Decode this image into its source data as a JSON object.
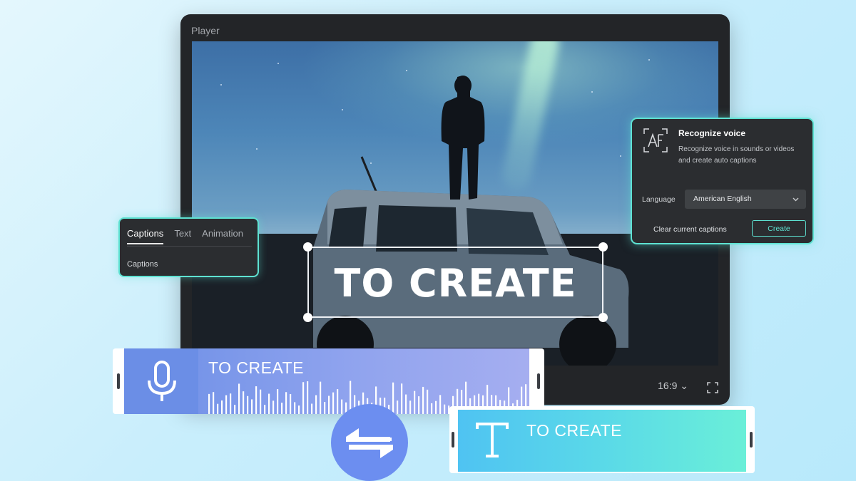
{
  "player": {
    "title": "Player",
    "aspect_ratio": "16:9",
    "caption_preview": "TO CREATE"
  },
  "captions_panel": {
    "tabs": [
      {
        "label": "Captions",
        "active": true
      },
      {
        "label": "Text",
        "active": false
      },
      {
        "label": "Animation",
        "active": false
      }
    ],
    "section_label": "Captions"
  },
  "voice_panel": {
    "title": "Recognize voice",
    "description": "Recognize voice in sounds or videos and create auto captions",
    "language_label": "Language",
    "language_value": "American English",
    "clear_label": "Clear current captions",
    "create_label": "Create",
    "icon": "auto-caption-icon"
  },
  "timeline": {
    "voice_clip_label": "TO CREATE",
    "text_clip_label": "TO CREATE",
    "voice_icon": "microphone-icon",
    "text_icon": "text-t-icon",
    "convert_icon": "convert-arrows-icon"
  },
  "colors": {
    "accent": "#5ee2d2",
    "panel_bg": "#2b2d30",
    "voice_clip": "#6b8ee6",
    "text_clip_start": "#4fc3f2",
    "text_clip_end": "#6aefd8"
  }
}
